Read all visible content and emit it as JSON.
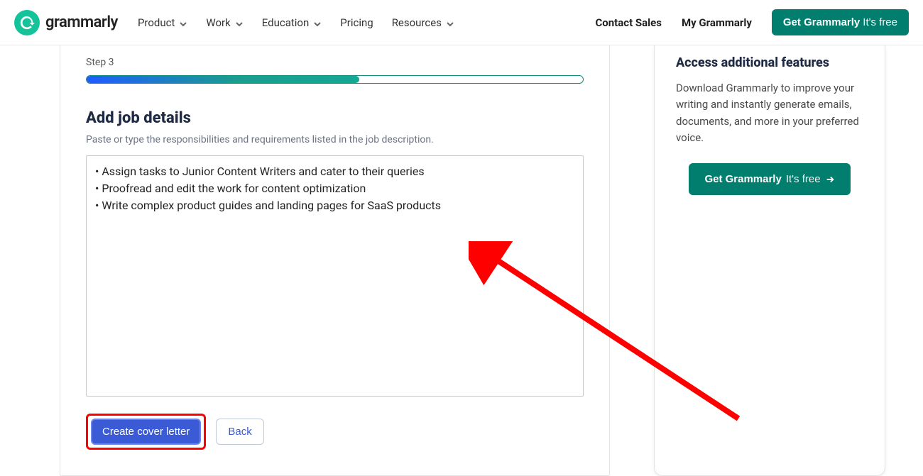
{
  "brand": {
    "name": "grammarly"
  },
  "nav": {
    "items": [
      {
        "label": "Product",
        "has_chevron": true
      },
      {
        "label": "Work",
        "has_chevron": true
      },
      {
        "label": "Education",
        "has_chevron": true
      },
      {
        "label": "Pricing",
        "has_chevron": false
      },
      {
        "label": "Resources",
        "has_chevron": true
      }
    ]
  },
  "header": {
    "contact_sales": "Contact Sales",
    "my_grammarly": "My Grammarly",
    "cta_bold": "Get Grammarly",
    "cta_light": " It's free"
  },
  "main": {
    "step_label": "Step 3",
    "progress_percent": 55,
    "title": "Add job details",
    "subtitle": "Paste or type the responsibilities and requirements listed in the job description.",
    "textarea_value": "• Assign tasks to Junior Content Writers and cater to their queries\n• Proofread and edit the work for content optimization\n• Write complex product guides and landing pages for SaaS products",
    "create_label": "Create cover letter",
    "back_label": "Back"
  },
  "sidebar": {
    "title": "Access additional features",
    "desc": "Download Grammarly to improve your writing and instantly generate emails, documents, and more in your preferred voice.",
    "cta_bold": "Get Grammarly",
    "cta_light": " It's free"
  },
  "colors": {
    "brand_green": "#027e6f",
    "logo_green": "#15c39a",
    "primary_blue": "#3b5bd6",
    "annotation_red": "#ff0000"
  }
}
